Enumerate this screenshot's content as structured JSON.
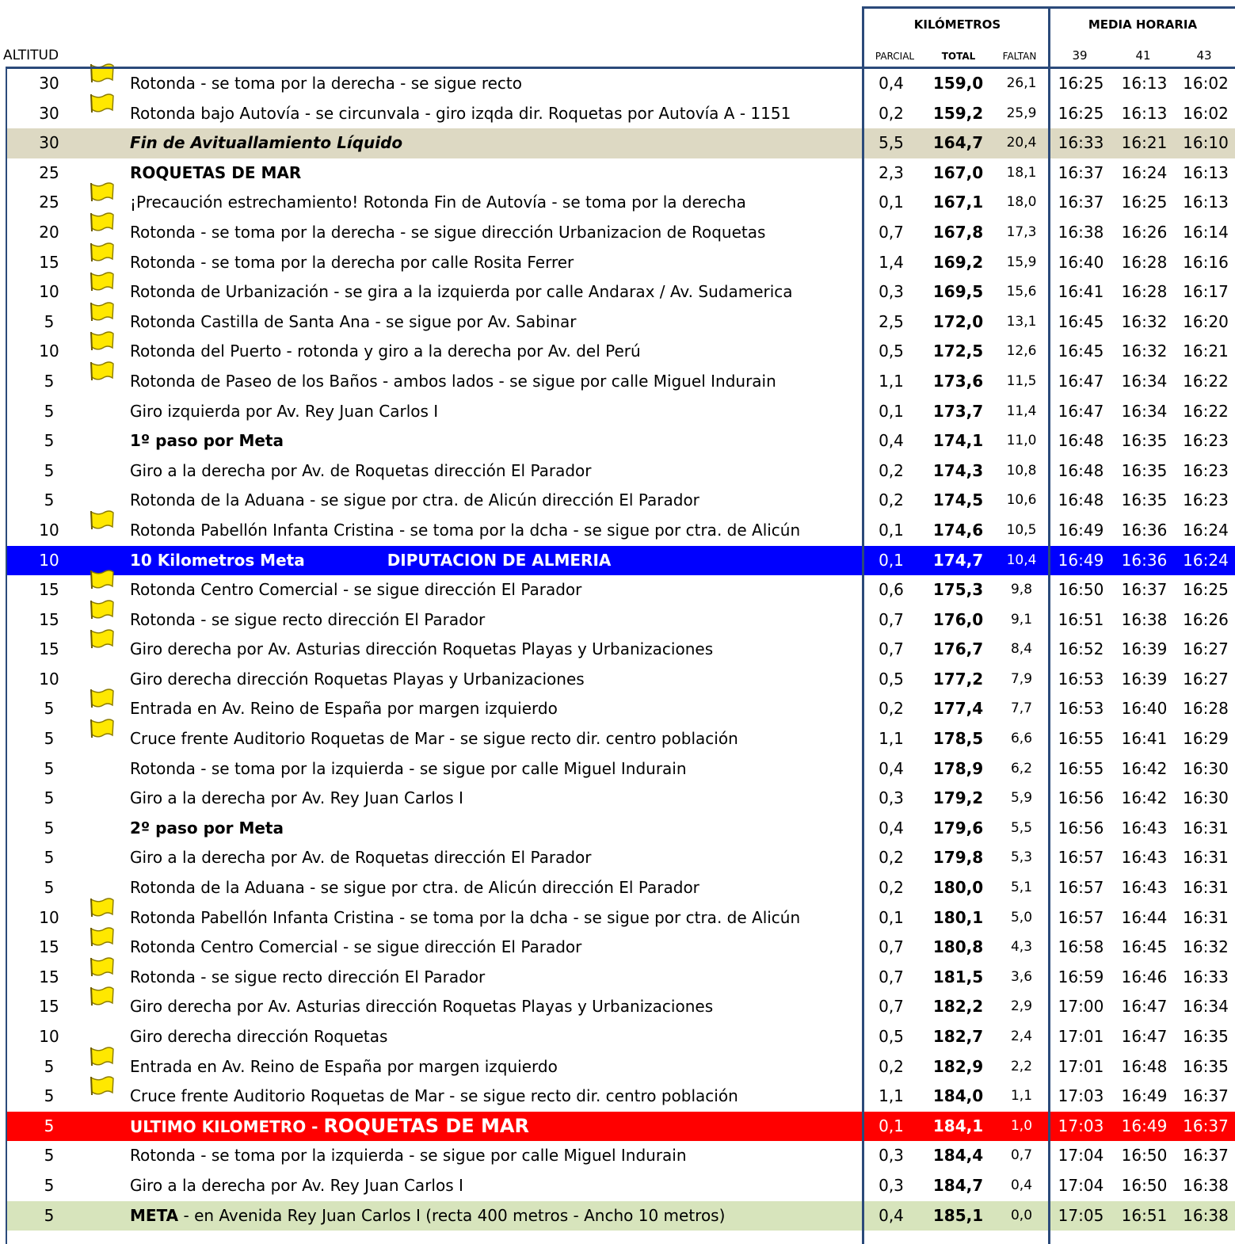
{
  "header": {
    "kilometros": "KILÓMETROS",
    "media_horaria": "MEDIA HORARIA",
    "altitud": "ALTITUD",
    "parcial": "PARCIAL",
    "total": "TOTAL",
    "faltan": "FALTAN",
    "speeds": [
      "39",
      "41",
      "43"
    ]
  },
  "colors": {
    "blue_row": "#0000ff",
    "red_row": "#ff0000",
    "tan_row": "#ddd9c3",
    "green_row": "#d7e4bc",
    "flag": "#ffe800"
  },
  "rows": [
    {
      "alt": "30",
      "flag": true,
      "desc": "Rotonda - se toma por la derecha - se sigue recto",
      "par": "0,4",
      "tot": "159,0",
      "fal": "26,1",
      "t": [
        "16:25",
        "16:13",
        "16:02"
      ]
    },
    {
      "alt": "30",
      "flag": true,
      "desc": "Rotonda bajo Autovía - se circunvala - giro izqda dir. Roquetas por Autovía A - 1151",
      "par": "0,2",
      "tot": "159,2",
      "fal": "25,9",
      "t": [
        "16:25",
        "16:13",
        "16:02"
      ]
    },
    {
      "alt": "30",
      "flag": false,
      "desc": "Fin de Avituallamiento Líquido",
      "par": "5,5",
      "tot": "164,7",
      "fal": "20,4",
      "t": [
        "16:33",
        "16:21",
        "16:10"
      ]
    },
    {
      "alt": "25",
      "flag": false,
      "desc": "ROQUETAS DE MAR",
      "par": "2,3",
      "tot": "167,0",
      "fal": "18,1",
      "t": [
        "16:37",
        "16:24",
        "16:13"
      ]
    },
    {
      "alt": "25",
      "flag": true,
      "desc": "¡Precaución estrechamiento! Rotonda Fin de Autovía - se toma por la derecha",
      "par": "0,1",
      "tot": "167,1",
      "fal": "18,0",
      "t": [
        "16:37",
        "16:25",
        "16:13"
      ]
    },
    {
      "alt": "20",
      "flag": true,
      "desc": "Rotonda - se toma por la derecha - se sigue dirección Urbanizacion de Roquetas",
      "par": "0,7",
      "tot": "167,8",
      "fal": "17,3",
      "t": [
        "16:38",
        "16:26",
        "16:14"
      ]
    },
    {
      "alt": "15",
      "flag": true,
      "desc": "Rotonda - se toma por la derecha por calle Rosita Ferrer",
      "par": "1,4",
      "tot": "169,2",
      "fal": "15,9",
      "t": [
        "16:40",
        "16:28",
        "16:16"
      ]
    },
    {
      "alt": "10",
      "flag": true,
      "desc": "Rotonda de Urbanización - se gira a la izquierda por calle Andarax / Av. Sudamerica",
      "par": "0,3",
      "tot": "169,5",
      "fal": "15,6",
      "t": [
        "16:41",
        "16:28",
        "16:17"
      ]
    },
    {
      "alt": "5",
      "flag": true,
      "desc": "Rotonda Castilla de Santa Ana - se sigue por Av. Sabinar",
      "par": "2,5",
      "tot": "172,0",
      "fal": "13,1",
      "t": [
        "16:45",
        "16:32",
        "16:20"
      ]
    },
    {
      "alt": "10",
      "flag": true,
      "desc": "Rotonda del Puerto - rotonda y giro a la derecha por Av. del Perú",
      "par": "0,5",
      "tot": "172,5",
      "fal": "12,6",
      "t": [
        "16:45",
        "16:32",
        "16:21"
      ]
    },
    {
      "alt": "5",
      "flag": true,
      "desc": "Rotonda de Paseo de los Baños - ambos lados - se sigue por calle Miguel Indurain",
      "par": "1,1",
      "tot": "173,6",
      "fal": "11,5",
      "t": [
        "16:47",
        "16:34",
        "16:22"
      ]
    },
    {
      "alt": "5",
      "flag": false,
      "desc": "Giro izquierda por Av. Rey Juan Carlos I",
      "par": "0,1",
      "tot": "173,7",
      "fal": "11,4",
      "t": [
        "16:47",
        "16:34",
        "16:22"
      ]
    },
    {
      "alt": "5",
      "flag": false,
      "desc": "1º paso por Meta",
      "par": "0,4",
      "tot": "174,1",
      "fal": "11,0",
      "t": [
        "16:48",
        "16:35",
        "16:23"
      ]
    },
    {
      "alt": "5",
      "flag": false,
      "desc": "Giro a la derecha por Av. de Roquetas dirección El Parador",
      "par": "0,2",
      "tot": "174,3",
      "fal": "10,8",
      "t": [
        "16:48",
        "16:35",
        "16:23"
      ]
    },
    {
      "alt": "5",
      "flag": false,
      "desc": "Rotonda de la Aduana - se sigue por ctra. de Alicún dirección El Parador",
      "par": "0,2",
      "tot": "174,5",
      "fal": "10,6",
      "t": [
        "16:48",
        "16:35",
        "16:23"
      ]
    },
    {
      "alt": "10",
      "flag": true,
      "desc": "Rotonda Pabellón Infanta Cristina - se toma por la dcha - se sigue por ctra. de Alicún",
      "par": "0,1",
      "tot": "174,6",
      "fal": "10,5",
      "t": [
        "16:49",
        "16:36",
        "16:24"
      ]
    },
    {
      "alt": "10",
      "flag": false,
      "desc": "10  Kilometros   Meta",
      "desc2": "DIPUTACION DE ALMERIA",
      "par": "0,1",
      "tot": "174,7",
      "fal": "10,4",
      "t": [
        "16:49",
        "16:36",
        "16:24"
      ]
    },
    {
      "alt": "15",
      "flag": true,
      "desc": "Rotonda Centro Comercial - se sigue dirección El Parador",
      "par": "0,6",
      "tot": "175,3",
      "fal": "9,8",
      "t": [
        "16:50",
        "16:37",
        "16:25"
      ]
    },
    {
      "alt": "15",
      "flag": true,
      "desc": "Rotonda - se sigue recto dirección El Parador",
      "par": "0,7",
      "tot": "176,0",
      "fal": "9,1",
      "t": [
        "16:51",
        "16:38",
        "16:26"
      ]
    },
    {
      "alt": "15",
      "flag": true,
      "desc": "Giro derecha por Av. Asturias dirección Roquetas Playas y Urbanizaciones",
      "par": "0,7",
      "tot": "176,7",
      "fal": "8,4",
      "t": [
        "16:52",
        "16:39",
        "16:27"
      ]
    },
    {
      "alt": "10",
      "flag": false,
      "desc": "Giro derecha dirección Roquetas Playas y Urbanizaciones",
      "par": "0,5",
      "tot": "177,2",
      "fal": "7,9",
      "t": [
        "16:53",
        "16:39",
        "16:27"
      ]
    },
    {
      "alt": "5",
      "flag": true,
      "desc": "Entrada en Av. Reino de España por margen izquierdo",
      "par": "0,2",
      "tot": "177,4",
      "fal": "7,7",
      "t": [
        "16:53",
        "16:40",
        "16:28"
      ]
    },
    {
      "alt": "5",
      "flag": true,
      "desc": "Cruce frente Auditorio Roquetas de Mar - se sigue recto dir. centro población",
      "par": "1,1",
      "tot": "178,5",
      "fal": "6,6",
      "t": [
        "16:55",
        "16:41",
        "16:29"
      ]
    },
    {
      "alt": "5",
      "flag": false,
      "desc": "Rotonda - se toma por la izquierda - se sigue por calle Miguel Indurain",
      "par": "0,4",
      "tot": "178,9",
      "fal": "6,2",
      "t": [
        "16:55",
        "16:42",
        "16:30"
      ]
    },
    {
      "alt": "5",
      "flag": false,
      "desc": "Giro a la derecha por Av. Rey Juan Carlos I",
      "par": "0,3",
      "tot": "179,2",
      "fal": "5,9",
      "t": [
        "16:56",
        "16:42",
        "16:30"
      ]
    },
    {
      "alt": "5",
      "flag": false,
      "desc": "2º paso por Meta",
      "par": "0,4",
      "tot": "179,6",
      "fal": "5,5",
      "t": [
        "16:56",
        "16:43",
        "16:31"
      ]
    },
    {
      "alt": "5",
      "flag": false,
      "desc": "Giro a la derecha por Av. de Roquetas dirección El Parador",
      "par": "0,2",
      "tot": "179,8",
      "fal": "5,3",
      "t": [
        "16:57",
        "16:43",
        "16:31"
      ]
    },
    {
      "alt": "5",
      "flag": false,
      "desc": "Rotonda de la Aduana - se sigue por ctra. de Alicún dirección El Parador",
      "par": "0,2",
      "tot": "180,0",
      "fal": "5,1",
      "t": [
        "16:57",
        "16:43",
        "16:31"
      ]
    },
    {
      "alt": "10",
      "flag": true,
      "desc": "Rotonda Pabellón Infanta Cristina - se toma por la dcha - se sigue por ctra. de Alicún",
      "par": "0,1",
      "tot": "180,1",
      "fal": "5,0",
      "t": [
        "16:57",
        "16:44",
        "16:31"
      ]
    },
    {
      "alt": "15",
      "flag": true,
      "desc": "Rotonda Centro Comercial - se sigue dirección El Parador",
      "par": "0,7",
      "tot": "180,8",
      "fal": "4,3",
      "t": [
        "16:58",
        "16:45",
        "16:32"
      ]
    },
    {
      "alt": "15",
      "flag": true,
      "desc": "Rotonda - se sigue recto dirección El Parador",
      "par": "0,7",
      "tot": "181,5",
      "fal": "3,6",
      "t": [
        "16:59",
        "16:46",
        "16:33"
      ]
    },
    {
      "alt": "15",
      "flag": true,
      "desc": "Giro derecha por Av. Asturias dirección Roquetas Playas y Urbanizaciones",
      "par": "0,7",
      "tot": "182,2",
      "fal": "2,9",
      "t": [
        "17:00",
        "16:47",
        "16:34"
      ]
    },
    {
      "alt": "10",
      "flag": false,
      "desc": "Giro derecha dirección Roquetas",
      "par": "0,5",
      "tot": "182,7",
      "fal": "2,4",
      "t": [
        "17:01",
        "16:47",
        "16:35"
      ]
    },
    {
      "alt": "5",
      "flag": true,
      "desc": "Entrada en Av. Reino de España por margen izquierdo",
      "par": "0,2",
      "tot": "182,9",
      "fal": "2,2",
      "t": [
        "17:01",
        "16:48",
        "16:35"
      ]
    },
    {
      "alt": "5",
      "flag": true,
      "desc": "Cruce frente Auditorio Roquetas de Mar - se sigue recto dir. centro población",
      "par": "1,1",
      "tot": "184,0",
      "fal": "1,1",
      "t": [
        "17:03",
        "16:49",
        "16:37"
      ]
    },
    {
      "alt": "5",
      "flag": false,
      "desc": "ULTIMO KILOMETRO - ",
      "desc2": "ROQUETAS DE MAR",
      "par": "0,1",
      "tot": "184,1",
      "fal": "1,0",
      "t": [
        "17:03",
        "16:49",
        "16:37"
      ]
    },
    {
      "alt": "5",
      "flag": false,
      "desc": "Rotonda - se toma por la izquierda - se sigue por calle Miguel Indurain",
      "par": "0,3",
      "tot": "184,4",
      "fal": "0,7",
      "t": [
        "17:04",
        "16:50",
        "16:37"
      ]
    },
    {
      "alt": "5",
      "flag": false,
      "desc": "Giro a la derecha por Av. Rey Juan Carlos I",
      "par": "0,3",
      "tot": "184,7",
      "fal": "0,4",
      "t": [
        "17:04",
        "16:50",
        "16:38"
      ]
    },
    {
      "alt": "5",
      "flag": false,
      "desc": "META",
      "desc2": " - en Avenida Rey Juan Carlos I (recta 400 metros - Ancho 10 metros)",
      "par": "0,4",
      "tot": "185,1",
      "fal": "0,0",
      "t": [
        "17:05",
        "16:51",
        "16:38"
      ]
    }
  ]
}
